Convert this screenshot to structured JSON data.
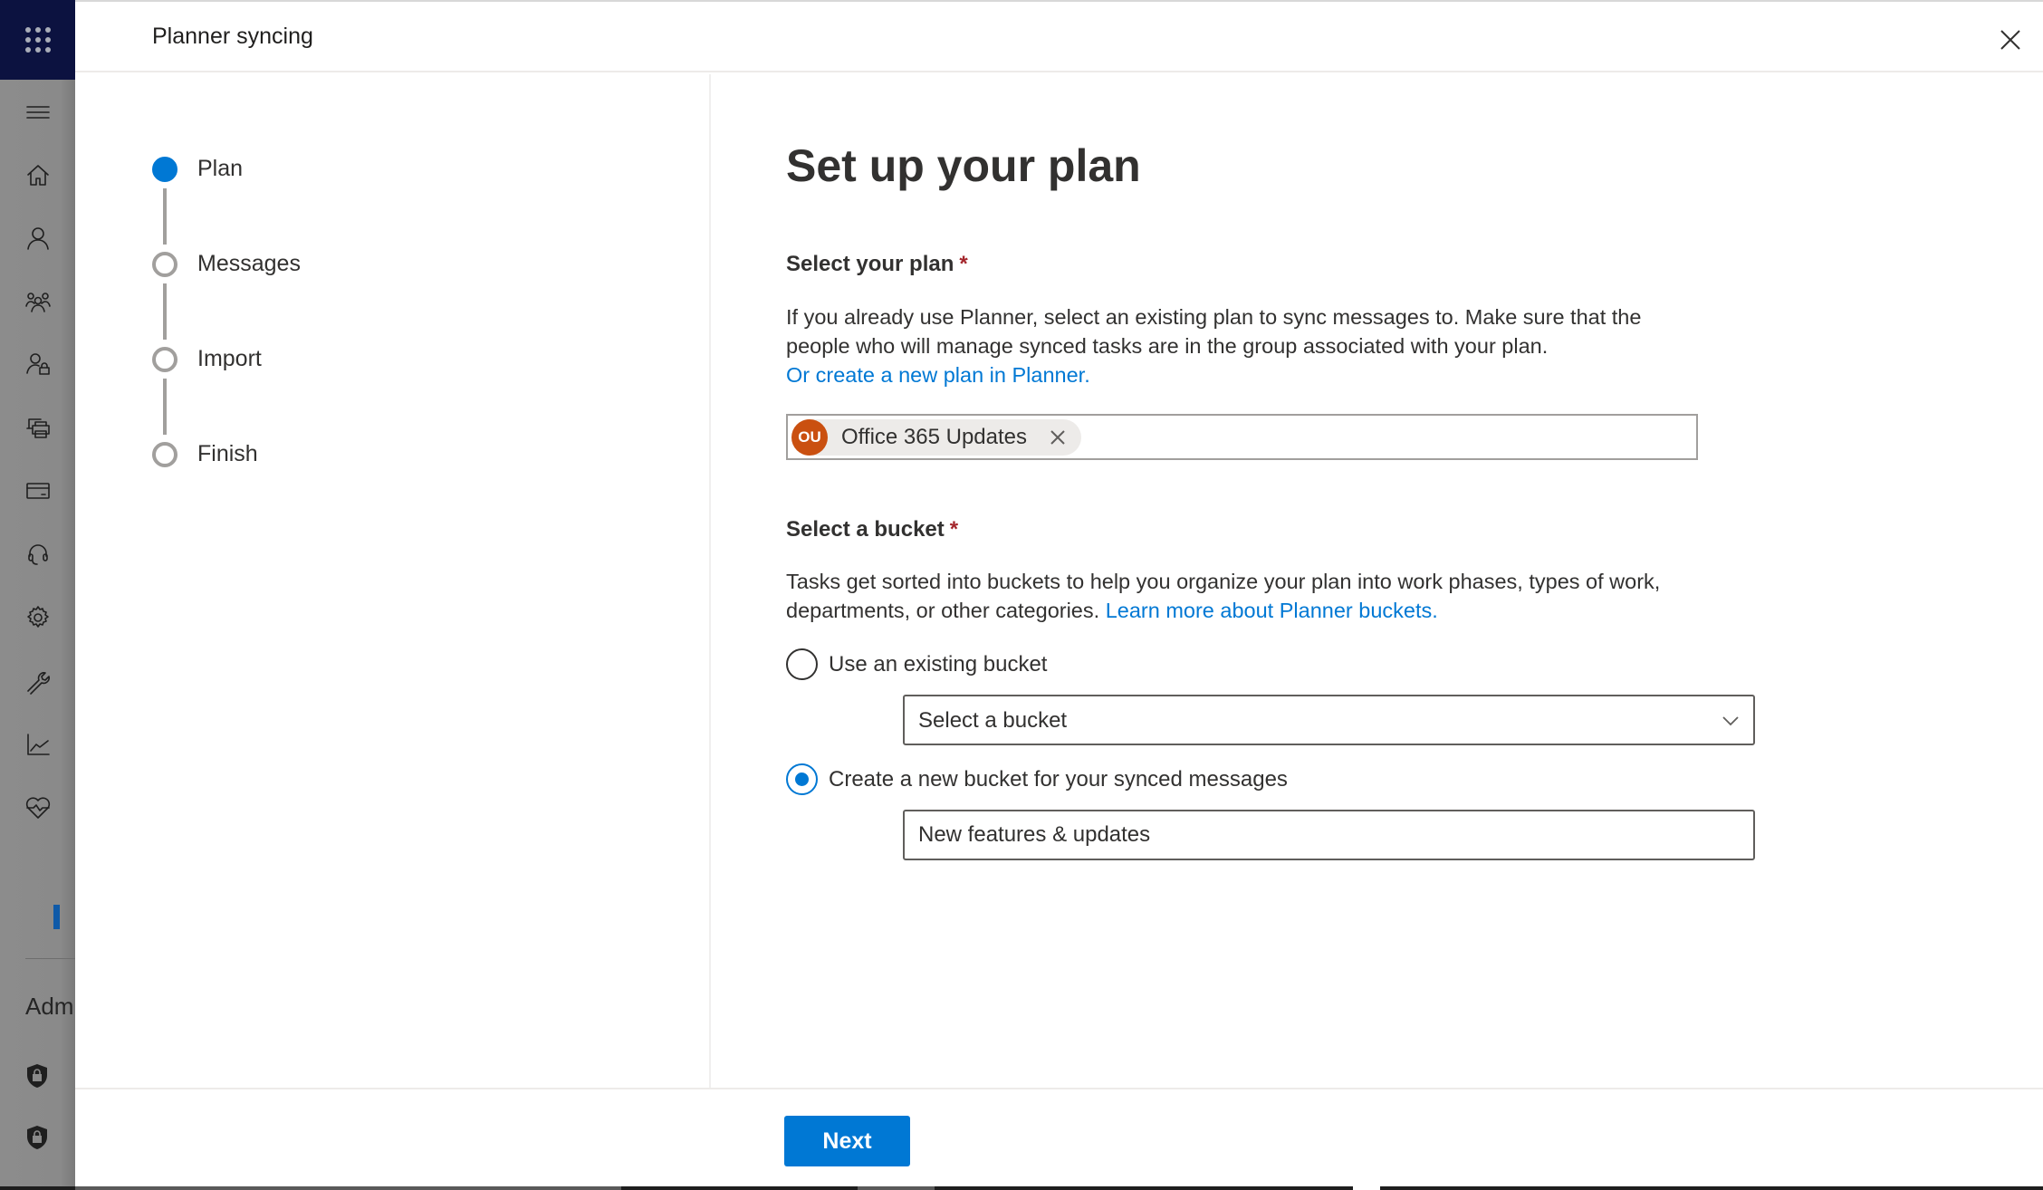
{
  "rail": {
    "app_launcher_icon": "waffle-icon",
    "items": [
      {
        "name": "menu",
        "icon": "hamburger-icon"
      },
      {
        "name": "home",
        "icon": "home-icon"
      },
      {
        "name": "users",
        "icon": "user-icon"
      },
      {
        "name": "teams-groups",
        "icon": "group-icon"
      },
      {
        "name": "roles",
        "icon": "user-lock-icon"
      },
      {
        "name": "resources",
        "icon": "printer-icon"
      },
      {
        "name": "billing",
        "icon": "credit-card-icon"
      },
      {
        "name": "support",
        "icon": "headset-icon"
      },
      {
        "name": "settings",
        "icon": "gear-icon"
      },
      {
        "name": "setup",
        "icon": "wrench-icon"
      },
      {
        "name": "reports",
        "icon": "line-chart-icon"
      },
      {
        "name": "health",
        "icon": "heart-pulse-icon"
      }
    ],
    "section_label": "Admi",
    "admin_centers": [
      {
        "icon": "shield-lock-icon"
      },
      {
        "icon": "shield-lock-icon"
      }
    ]
  },
  "panel": {
    "title": "Planner syncing",
    "close_icon": "close-icon"
  },
  "stepper": {
    "steps": [
      {
        "label": "Plan",
        "state": "current"
      },
      {
        "label": "Messages",
        "state": "pending"
      },
      {
        "label": "Import",
        "state": "pending"
      },
      {
        "label": "Finish",
        "state": "pending"
      }
    ]
  },
  "main": {
    "heading": "Set up your plan",
    "plan_section": {
      "label": "Select your plan",
      "required_marker": "*",
      "description": "If you already use Planner, select an existing plan to sync messages to. Make sure that the people who will manage synced tasks are in the group associated with your plan.",
      "link": "Or create a new plan in Planner.",
      "selected_plan": {
        "initials": "OU",
        "name": "Office 365 Updates",
        "avatar_color": "#ca5010"
      }
    },
    "bucket_section": {
      "label": "Select a bucket",
      "required_marker": "*",
      "description": "Tasks get sorted into buckets to help you organize your plan into work phases, types of work, departments, or other categories.",
      "link": "Learn more about Planner buckets.",
      "options": [
        {
          "label": "Use an existing bucket",
          "checked": false
        },
        {
          "label": "Create a new bucket for your synced messages",
          "checked": true
        }
      ],
      "dropdown_placeholder": "Select a bucket",
      "new_bucket_value": "New features & updates"
    }
  },
  "footer": {
    "next_label": "Next"
  },
  "colors": {
    "accent": "#0078d4",
    "required": "#a4262c",
    "rail_top": "#0c1240"
  }
}
